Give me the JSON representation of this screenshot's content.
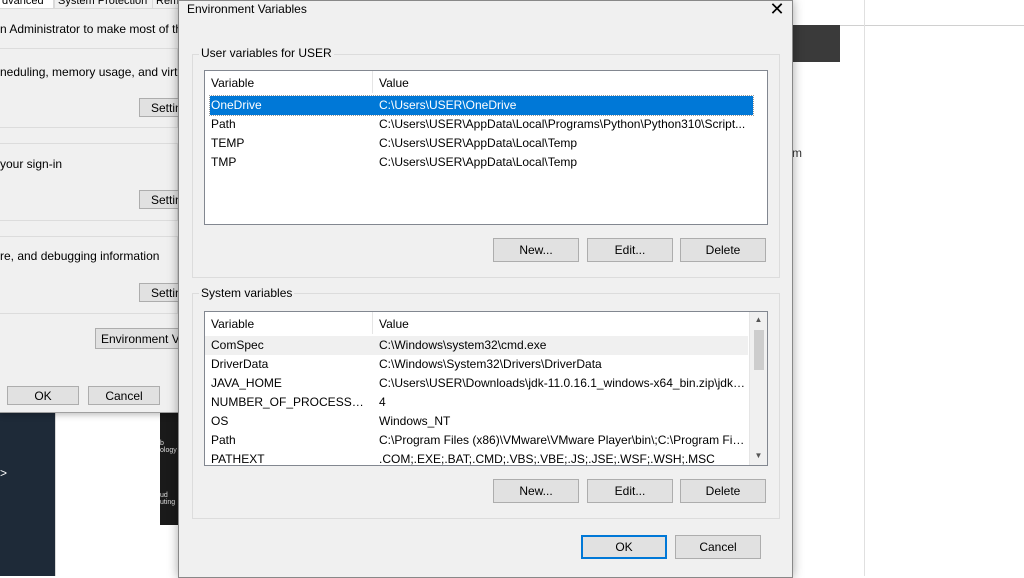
{
  "background": {
    "partial_text_m": "m",
    "dark_block_text": [
      "b",
      "ology",
      "ud",
      "uting"
    ],
    "arrow": ">"
  },
  "system_properties": {
    "tabs": [
      "dvanced",
      "System Protection",
      "Remo"
    ],
    "text_admin": "n Administrator to make most of these c",
    "text_perf": "neduling, memory usage, and virtual m",
    "settings_1": "Settin",
    "text_signin": "your sign-in",
    "settings_2": "Settin",
    "text_debug": "re, and debugging information",
    "settings_3": "Settin",
    "env_button": "Environment Var",
    "ok": "OK",
    "cancel": "Cancel"
  },
  "dialog": {
    "title": "Environment Variables",
    "close_glyph": "✕",
    "user_section": {
      "label": "User variables for USER",
      "col_variable": "Variable",
      "col_value": "Value",
      "rows": [
        {
          "variable": "OneDrive",
          "value": "C:\\Users\\USER\\OneDrive"
        },
        {
          "variable": "Path",
          "value": "C:\\Users\\USER\\AppData\\Local\\Programs\\Python\\Python310\\Script..."
        },
        {
          "variable": "TEMP",
          "value": "C:\\Users\\USER\\AppData\\Local\\Temp"
        },
        {
          "variable": "TMP",
          "value": "C:\\Users\\USER\\AppData\\Local\\Temp"
        }
      ],
      "btn_new": "New...",
      "btn_edit": "Edit...",
      "btn_delete": "Delete"
    },
    "system_section": {
      "label": "System variables",
      "col_variable": "Variable",
      "col_value": "Value",
      "rows": [
        {
          "variable": "ComSpec",
          "value": "C:\\Windows\\system32\\cmd.exe"
        },
        {
          "variable": "DriverData",
          "value": "C:\\Windows\\System32\\Drivers\\DriverData"
        },
        {
          "variable": "JAVA_HOME",
          "value": "C:\\Users\\USER\\Downloads\\jdk-11.0.16.1_windows-x64_bin.zip\\jdk-..."
        },
        {
          "variable": "NUMBER_OF_PROCESSORS",
          "value": "4"
        },
        {
          "variable": "OS",
          "value": "Windows_NT"
        },
        {
          "variable": "Path",
          "value": "C:\\Program Files (x86)\\VMware\\VMware Player\\bin\\;C:\\Program Fil..."
        },
        {
          "variable": "PATHEXT",
          "value": ".COM;.EXE;.BAT;.CMD;.VBS;.VBE;.JS;.JSE;.WSF;.WSH;.MSC"
        }
      ],
      "btn_new": "New...",
      "btn_edit": "Edit...",
      "btn_delete": "Delete"
    },
    "ok": "OK",
    "cancel": "Cancel"
  },
  "colors": {
    "selection": "#0078d7",
    "dialog_bg": "#f0f0f0"
  }
}
